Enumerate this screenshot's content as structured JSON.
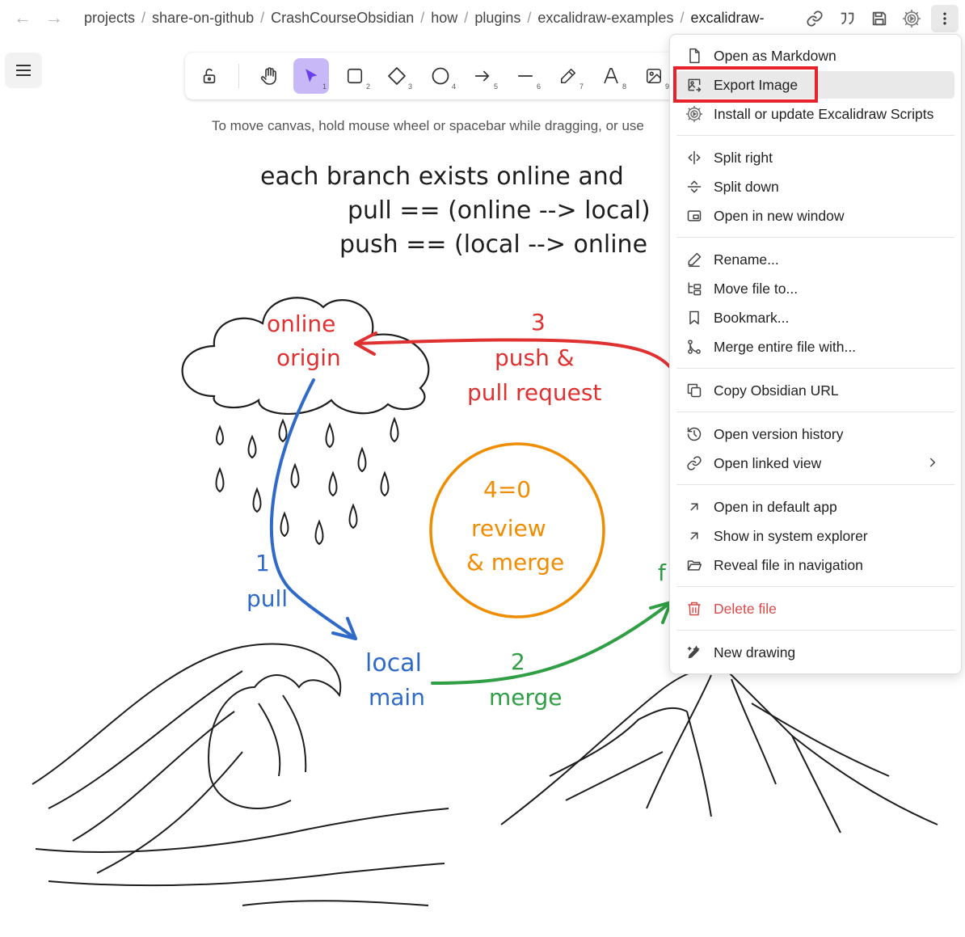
{
  "breadcrumb": {
    "items": [
      "projects",
      "share-on-github",
      "CrashCourseObsidian",
      "how",
      "plugins",
      "excalidraw-examples",
      "excalidraw-"
    ],
    "separator": "/"
  },
  "header_icons": [
    "link-icon",
    "quote-icon",
    "save-icon",
    "excalidraw-settings-icon",
    "more-options-icon"
  ],
  "toolbar": {
    "tools": [
      {
        "name": "lock",
        "key": ""
      },
      {
        "name": "hand",
        "key": ""
      },
      {
        "name": "selection",
        "key": "1"
      },
      {
        "name": "rectangle",
        "key": "2"
      },
      {
        "name": "diamond",
        "key": "3"
      },
      {
        "name": "ellipse",
        "key": "4"
      },
      {
        "name": "arrow",
        "key": "5"
      },
      {
        "name": "line",
        "key": "6"
      },
      {
        "name": "draw",
        "key": "7"
      },
      {
        "name": "text",
        "key": "8"
      },
      {
        "name": "image",
        "key": "9"
      }
    ]
  },
  "hint": "To move canvas, hold mouse wheel or spacebar while dragging, or use",
  "drawing": {
    "title_lines": [
      "each branch exists online and",
      "pull == (online --> local)",
      "push == (local --> online"
    ],
    "cloud_label": [
      "online",
      "origin"
    ],
    "arrow1": [
      "1",
      "pull"
    ],
    "arrow2": [
      "2",
      "merge"
    ],
    "arrow3": [
      "3",
      "push &",
      "pull request"
    ],
    "circle_label": [
      "4=0",
      "review",
      "& merge"
    ],
    "local_label": [
      "local",
      "main"
    ],
    "partial_label": "f",
    "colors": {
      "red": "#e03131",
      "blue": "#2f6ac9",
      "green": "#2f9e44",
      "orange": "#f08c00",
      "ink": "#1e1e1e"
    }
  },
  "menu": {
    "items": [
      {
        "label": "Open as Markdown",
        "icon": "file-icon"
      },
      {
        "label": "Export Image",
        "icon": "export-image-icon",
        "state": "hover"
      },
      {
        "label": "Install or update Excalidraw Scripts",
        "icon": "scripts-gear-icon"
      },
      {
        "label": "Split right",
        "icon": "split-right-icon"
      },
      {
        "label": "Split down",
        "icon": "split-down-icon"
      },
      {
        "label": "Open in new window",
        "icon": "new-window-icon"
      },
      {
        "label": "Rename...",
        "icon": "pencil-icon"
      },
      {
        "label": "Move file to...",
        "icon": "folder-tree-icon"
      },
      {
        "label": "Bookmark...",
        "icon": "bookmark-icon"
      },
      {
        "label": "Merge entire file with...",
        "icon": "git-merge-icon"
      },
      {
        "label": "Copy Obsidian URL",
        "icon": "copy-icon"
      },
      {
        "label": "Open version history",
        "icon": "history-icon"
      },
      {
        "label": "Open linked view",
        "icon": "link-icon"
      },
      {
        "label": "Open in default app",
        "icon": "arrow-up-right-icon"
      },
      {
        "label": "Show in system explorer",
        "icon": "arrow-up-right-icon"
      },
      {
        "label": "Reveal file in navigation",
        "icon": "folder-open-icon"
      },
      {
        "label": "Delete file",
        "icon": "trash-icon",
        "state": "danger"
      },
      {
        "label": "New drawing",
        "icon": "new-drawing-icon"
      }
    ]
  },
  "annotation_color": "#e8222b"
}
